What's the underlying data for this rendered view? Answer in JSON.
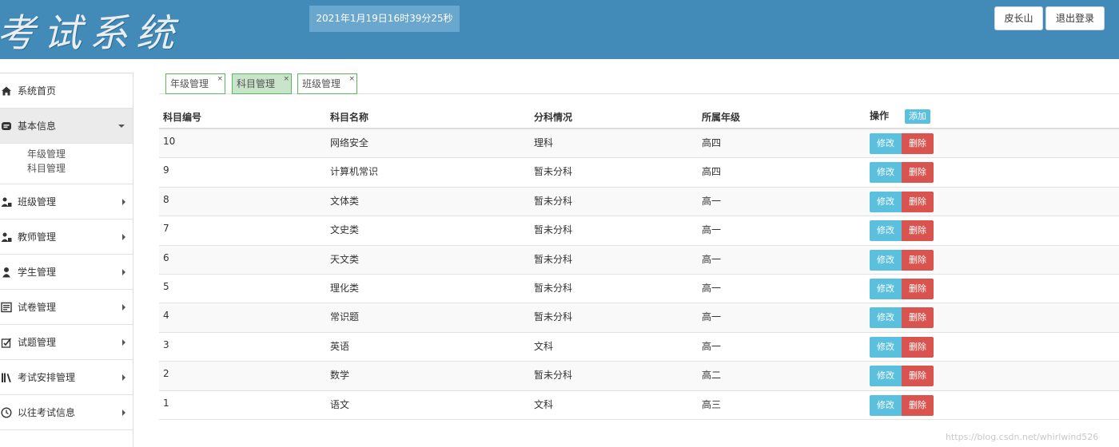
{
  "header": {
    "logo_text": "考试系统",
    "clock": "2021年1月19日16时39分25秒",
    "user_button": "皮长山",
    "logout_button": "退出登录"
  },
  "sidebar": {
    "items": [
      {
        "label": "系统首页",
        "icon": "home-icon"
      },
      {
        "label": "基本信息",
        "icon": "info-icon",
        "expanded": true,
        "children": [
          "年级管理",
          "科目管理"
        ]
      },
      {
        "label": "班级管理",
        "icon": "users-icon"
      },
      {
        "label": "教师管理",
        "icon": "teacher-icon"
      },
      {
        "label": "学生管理",
        "icon": "student-icon"
      },
      {
        "label": "试卷管理",
        "icon": "paper-icon"
      },
      {
        "label": "试题管理",
        "icon": "question-icon"
      },
      {
        "label": "考试安排管理",
        "icon": "books-icon"
      },
      {
        "label": "以往考试信息",
        "icon": "clock-icon"
      }
    ]
  },
  "tabs": [
    {
      "label": "年级管理",
      "active": false
    },
    {
      "label": "科目管理",
      "active": true
    },
    {
      "label": "班级管理",
      "active": false
    }
  ],
  "tab_close_symbol": "×",
  "table": {
    "columns": [
      "科目编号",
      "科目名称",
      "分科情况",
      "所属年级",
      "操作"
    ],
    "add_label": "添加",
    "edit_label": "修改",
    "delete_label": "删除",
    "rows": [
      {
        "id": "10",
        "name": "网络安全",
        "branch": "理科",
        "grade": "高四"
      },
      {
        "id": "9",
        "name": "计算机常识",
        "branch": "暂未分科",
        "grade": "高四"
      },
      {
        "id": "8",
        "name": "文体类",
        "branch": "暂未分科",
        "grade": "高一"
      },
      {
        "id": "7",
        "name": "文史类",
        "branch": "暂未分科",
        "grade": "高一"
      },
      {
        "id": "6",
        "name": "天文类",
        "branch": "暂未分科",
        "grade": "高一"
      },
      {
        "id": "5",
        "name": "理化类",
        "branch": "暂未分科",
        "grade": "高一"
      },
      {
        "id": "4",
        "name": "常识题",
        "branch": "暂未分科",
        "grade": "高一"
      },
      {
        "id": "3",
        "name": "英语",
        "branch": "文科",
        "grade": "高一"
      },
      {
        "id": "2",
        "name": "数学",
        "branch": "暂未分科",
        "grade": "高二"
      },
      {
        "id": "1",
        "name": "语文",
        "branch": "文科",
        "grade": "高三"
      }
    ]
  },
  "watermark": "https://blog.csdn.net/whirlwind526",
  "colors": {
    "header_bg": "#428bb8",
    "info": "#5bc0de",
    "danger": "#d9534f",
    "tab_border": "#5cb85c"
  }
}
